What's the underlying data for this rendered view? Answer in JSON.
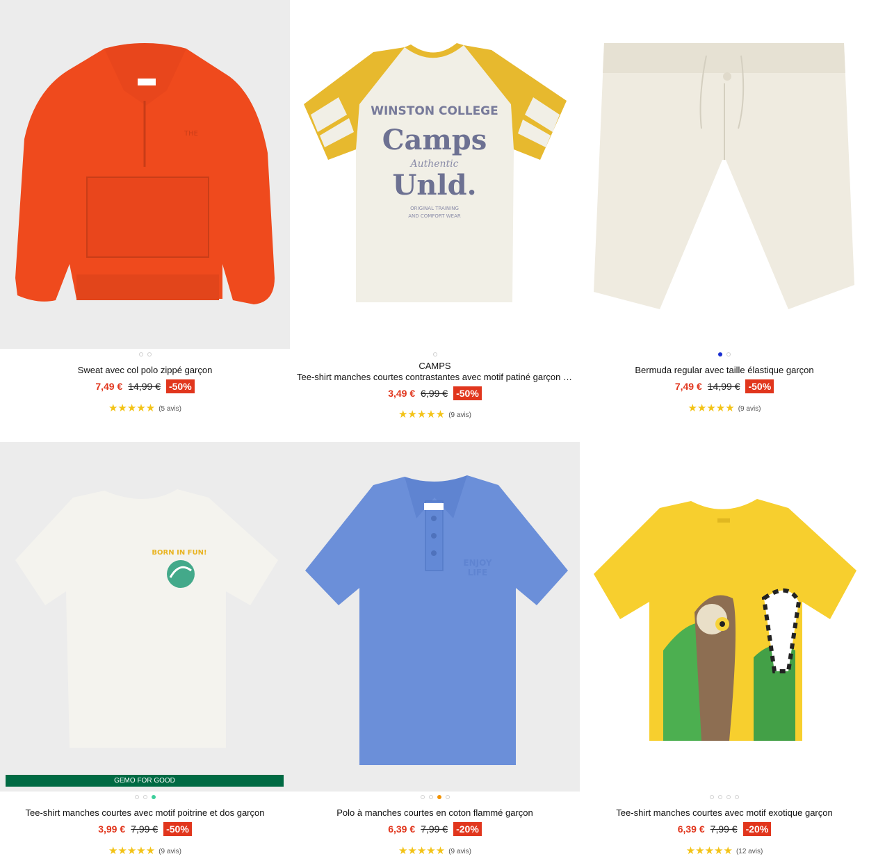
{
  "products": [
    {
      "title": "Sweat avec col polo zippé garçon",
      "price": "7,49 €",
      "old_price": "14,99 €",
      "discount": "-50%",
      "stars": "★★★★★",
      "rating_count": "(5 avis)",
      "dots": 2,
      "active_dot": -1,
      "image_icon": "orange-sweatshirt-icon"
    },
    {
      "brand": "CAMPS",
      "title": "Tee-shirt manches courtes contrastantes avec motif patiné garçon - …",
      "price": "3,49 €",
      "old_price": "6,99 €",
      "discount": "-50%",
      "stars": "★★★★★",
      "rating_count": "(9 avis)",
      "dots": 1,
      "active_dot": -1,
      "image_icon": "raglan-tshirt-icon",
      "print": {
        "line1": "WINSTON COLLEGE",
        "line2": "Camps",
        "line3": "Authentic",
        "line4": "Unld.",
        "line5": "ORIGINAL TRAINING",
        "line6": "AND COMFORT WEAR"
      }
    },
    {
      "title": "Bermuda regular avec taille élastique garçon",
      "price": "7,49 €",
      "old_price": "14,99 €",
      "discount": "-50%",
      "stars": "★★★★★",
      "rating_count": "(9 avis)",
      "dots": 2,
      "active_dot": 0,
      "image_icon": "shorts-icon"
    },
    {
      "title": "Tee-shirt manches courtes avec motif poitrine et dos garçon",
      "price": "3,99 €",
      "old_price": "7,99 €",
      "discount": "-50%",
      "stars": "★★★★★",
      "rating_count": "(9 avis)",
      "dots": 3,
      "active_dot": 2,
      "badge": "GEMO FOR GOOD",
      "image_icon": "white-tshirt-icon"
    },
    {
      "title": "Polo à manches courtes en coton flammé garçon",
      "price": "6,39 €",
      "old_price": "7,99 €",
      "discount": "-20%",
      "stars": "★★★★★",
      "rating_count": "(9 avis)",
      "dots": 4,
      "active_dot": 2,
      "image_icon": "blue-polo-icon"
    },
    {
      "title": "Tee-shirt manches courtes avec motif exotique garçon",
      "price": "6,39 €",
      "old_price": "7,99 €",
      "discount": "-20%",
      "stars": "★★★★★",
      "rating_count": "(12 avis)",
      "dots": 4,
      "active_dot": -1,
      "image_icon": "yellow-lemur-tshirt-icon"
    }
  ],
  "colors": {
    "price": "#e1361d",
    "star": "#f3c317",
    "badge": "#006a43",
    "dot_active_blue": "#1a2fd1",
    "dot_active_green": "#3ecf9b",
    "dot_active_orange": "#f39200"
  }
}
